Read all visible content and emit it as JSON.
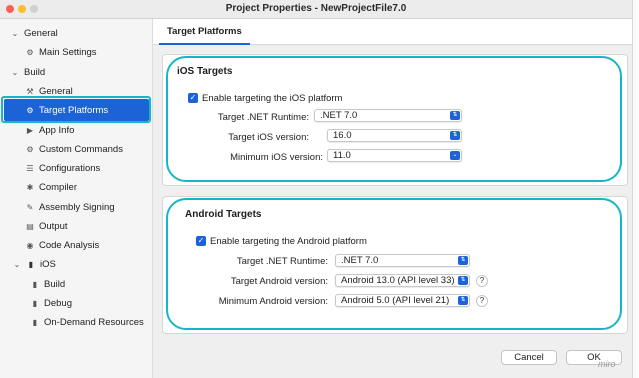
{
  "window": {
    "title": "Project Properties - NewProjectFile7.0"
  },
  "sidebar": {
    "items": [
      {
        "label": "General",
        "icon": "chevron-down-icon",
        "level": 0
      },
      {
        "label": "Main Settings",
        "icon": "gear-icon",
        "level": 1
      },
      {
        "label": "Build",
        "icon": "chevron-down-icon",
        "level": 0
      },
      {
        "label": "General",
        "icon": "hammer-icon",
        "level": 1
      },
      {
        "label": "Target Platforms",
        "icon": "gear-icon",
        "level": 1,
        "selected": true
      },
      {
        "label": "App Info",
        "icon": "play-icon",
        "level": 1
      },
      {
        "label": "Custom Commands",
        "icon": "gear-icon",
        "level": 1
      },
      {
        "label": "Configurations",
        "icon": "list-icon",
        "level": 1
      },
      {
        "label": "Compiler",
        "icon": "compiler-icon",
        "level": 1
      },
      {
        "label": "Assembly Signing",
        "icon": "signing-icon",
        "level": 1
      },
      {
        "label": "Output",
        "icon": "output-icon",
        "level": 1
      },
      {
        "label": "Code Analysis",
        "icon": "target-icon",
        "level": 1
      },
      {
        "label": "iOS",
        "icon": "chevron-down-icon",
        "level": 1
      },
      {
        "label": "Build",
        "icon": "square-icon",
        "level": 2
      },
      {
        "label": "Debug",
        "icon": "square-icon",
        "level": 2
      },
      {
        "label": "On-Demand Resources",
        "icon": "square-icon",
        "level": 2
      }
    ]
  },
  "tab": {
    "label": "Target Platforms"
  },
  "ios": {
    "title": "iOS Targets",
    "checkbox_label": "Enable targeting the iOS platform",
    "checked": true,
    "runtime_label": "Target .NET Runtime:",
    "runtime_value": ".NET 7.0",
    "target_label": "Target iOS version:",
    "target_value": "16.0",
    "min_label": "Minimum iOS version:",
    "min_value": "11.0"
  },
  "android": {
    "title": "Android Targets",
    "checkbox_label": "Enable targeting the Android platform",
    "checked": true,
    "runtime_label": "Target .NET Runtime:",
    "runtime_value": ".NET 7.0",
    "target_label": "Target Android version:",
    "target_value": "Android 13.0 (API level 33)",
    "min_label": "Minimum Android version:",
    "min_value": "Android 5.0 (API level 21)",
    "help_symbol": "?"
  },
  "footer": {
    "cancel_label": "Cancel",
    "ok_label": "OK"
  },
  "watermark": "miro",
  "colors": {
    "accent": "#1d63d8",
    "highlight": "#16b6c7"
  }
}
